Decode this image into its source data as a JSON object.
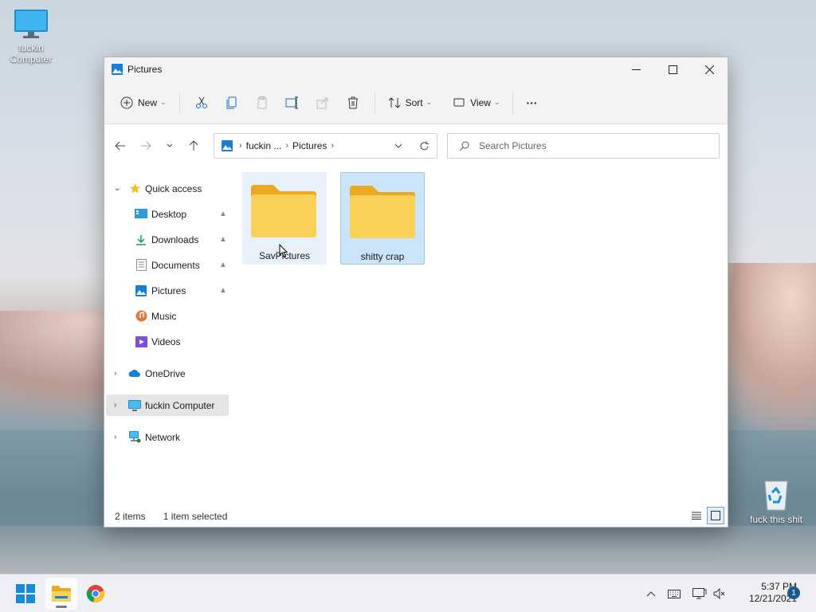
{
  "desktop": {
    "icons": [
      {
        "label": "fuckin Computer"
      },
      {
        "label": "fuck this shit"
      }
    ]
  },
  "window": {
    "title": "Pictures",
    "toolbar": {
      "new_label": "New",
      "sort_label": "Sort",
      "view_label": "View",
      "more_label": "···"
    },
    "address": {
      "segments": [
        "fuckin ...",
        "Pictures"
      ]
    },
    "search": {
      "placeholder": "Search Pictures"
    },
    "sidebar": {
      "quick_access": "Quick access",
      "pinned": [
        "Desktop",
        "Downloads",
        "Documents",
        "Pictures"
      ],
      "unpinned": [
        "Music",
        "Videos"
      ],
      "onedrive": "OneDrive",
      "computer": "fuckin Computer",
      "network": "Network"
    },
    "items": [
      {
        "name": "SavPictures",
        "state": "hover"
      },
      {
        "name": "shitty crap",
        "state": "selected"
      }
    ],
    "status": {
      "count": "2 items",
      "selection": "1 item selected"
    }
  },
  "taskbar": {
    "apps": [
      "start-icon",
      "file-explorer-icon",
      "chrome-icon"
    ],
    "time": "5:37 PM",
    "date": "12/21/2021",
    "notifications": "1"
  },
  "colors": {
    "accent": "#0067c0",
    "folder": "#f8c94a",
    "selection": "#cce4f7"
  }
}
